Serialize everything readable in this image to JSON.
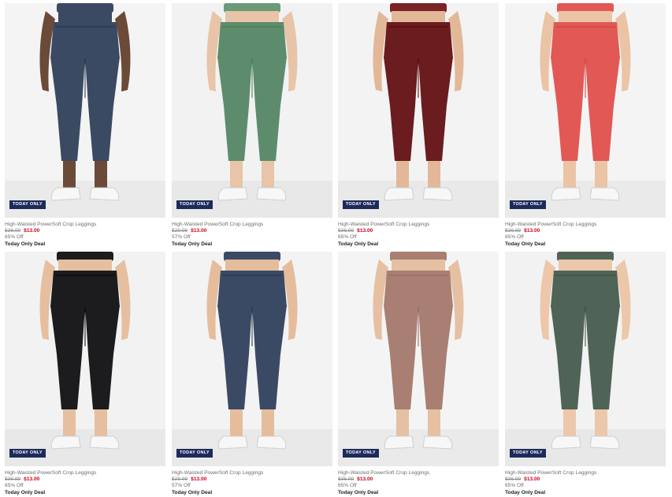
{
  "products": [
    {
      "name": "High-Waisted PowerSoft Crop Leggings",
      "orig_price": "$36.99",
      "sale_price": "$13.00",
      "discount": "65% Off",
      "deal": "Today Only Deal",
      "badge": "TODAY ONLY",
      "color": "#3a4a62",
      "skin": "#6b4a37",
      "top": "#3a4a62",
      "bg": "#f4f4f4"
    },
    {
      "name": "High-Waisted PowerSoft Crop Leggings",
      "orig_price": "$29.99",
      "sale_price": "$13.00",
      "discount": "57% Off",
      "deal": "Today Only Deal",
      "badge": "TODAY ONLY",
      "color": "#5d8c6c",
      "skin": "#e8c4a8",
      "top": "#6a9a78",
      "bg": "#f2f2f2"
    },
    {
      "name": "High-Waisted PowerSoft Crop Leggings",
      "orig_price": "$36.99",
      "sale_price": "$13.00",
      "discount": "65% Off",
      "deal": "Today Only Deal",
      "badge": "TODAY ONLY",
      "color": "#6a1c1e",
      "skin": "#e2b898",
      "top": "#7a2226",
      "bg": "#f3f3f3"
    },
    {
      "name": "High-Waisted PowerSoft Crop Leggings",
      "orig_price": "$36.99",
      "sale_price": "$13.00",
      "discount": "65% Off",
      "deal": "Today Only Deal",
      "badge": "TODAY ONLY",
      "color": "#e25855",
      "skin": "#eac4a4",
      "top": "#e25855",
      "bg": "#f4f4f4"
    },
    {
      "name": "High-Waisted PowerSoft Crop Leggings",
      "orig_price": "$36.99",
      "sale_price": "$13.00",
      "discount": "65% Off",
      "deal": "Today Only Deal",
      "badge": "TODAY ONLY",
      "color": "#1c1c1e",
      "skin": "#e6bfa0",
      "top": "#1c1c1e",
      "bg": "#f2f2f2"
    },
    {
      "name": "High-Waisted PowerSoft Crop Leggings",
      "orig_price": "$29.99",
      "sale_price": "$13.00",
      "discount": "57% Off",
      "deal": "Today Only Deal",
      "badge": "TODAY ONLY",
      "color": "#3b4a64",
      "skin": "#e5bd9c",
      "top": "#3b4a64",
      "bg": "#f3f3f3"
    },
    {
      "name": "High-Waisted PowerSoft Crop Leggings",
      "orig_price": "$36.99",
      "sale_price": "$13.00",
      "discount": "65% Off",
      "deal": "Today Only Deal",
      "badge": "TODAY ONLY",
      "color": "#a87f72",
      "skin": "#e5c0a2",
      "top": "#a87f72",
      "bg": "#f4f4f4"
    },
    {
      "name": "High-Waisted PowerSoft Crop Leggings",
      "orig_price": "$36.99",
      "sale_price": "$13.00",
      "discount": "65% Off",
      "deal": "Today Only Deal",
      "badge": "TODAY ONLY",
      "color": "#4f6356",
      "skin": "#ecc7aa",
      "top": "#4f6356",
      "bg": "#f2f2f2"
    }
  ]
}
